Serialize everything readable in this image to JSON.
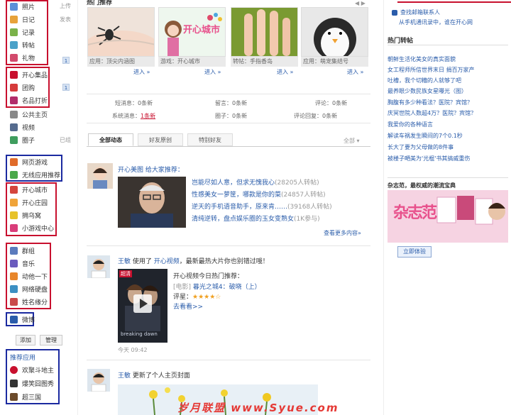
{
  "sidebar": {
    "hint_items": [
      "上传",
      "发表"
    ],
    "group1": [
      "照片",
      "日记",
      "记录",
      "转帖",
      "礼物"
    ],
    "group1_badge": "1",
    "group2": [
      "开心集品",
      "团购",
      "名品打折"
    ],
    "group2_badge": "1",
    "plain": [
      "公共主页",
      "视频",
      "圈子"
    ],
    "plain_hint": "已组",
    "group3": [
      "网页游戏",
      "无线应用推荐"
    ],
    "group4": [
      "开心城市",
      "开心庄园",
      "拥乌窝",
      "小游戏中心"
    ],
    "group5": [
      "群组",
      "音乐",
      "动他一下",
      "网络硬盘",
      "姓名缘分"
    ],
    "group6": [
      "微博"
    ],
    "add_label": "添加",
    "manage_label": "管理",
    "recommend_title": "推荐应用",
    "recommend": [
      "欢聚斗地主",
      "爆笑囧图秀",
      "超三国"
    ]
  },
  "top": {
    "section_title": "热门推荐",
    "photos": [
      {
        "caption": "应用：顶尖内涵图",
        "enter": "进入 »"
      },
      {
        "caption": "游戏：开心城市",
        "enter": "进入 »",
        "logo": "开心城市"
      },
      {
        "caption": "转帖：手指香岛",
        "enter": "进入 »"
      },
      {
        "caption": "应用：萌宠集结号",
        "enter": "进入 »"
      }
    ],
    "more_arrows": "◀ ▶"
  },
  "messages": {
    "rows": [
      [
        {
          "label": "短消息：",
          "value": "0条新"
        },
        {
          "label": "留言：",
          "value": "0条新"
        },
        {
          "label": "评论：",
          "value": "0条新"
        }
      ],
      [
        {
          "label": "系统消息：",
          "value": "1条新"
        },
        {
          "label": "圈子：",
          "value": "0条新"
        },
        {
          "label": "评论回复：",
          "value": "0条新"
        }
      ]
    ]
  },
  "tabs": {
    "items": [
      "全部动态",
      "好友原创",
      "特别好友"
    ],
    "filter": "全部 ▾"
  },
  "feed": {
    "post1": {
      "header": "开心美图 给大家推荐：",
      "items": [
        {
          "title": "岂能尽如人意，但求无愧我心",
          "meta": "(28205人转帖)"
        },
        {
          "title": "性感美女一萝筐，哪款是你的菜",
          "meta": "(24857人转帖)"
        },
        {
          "title": "逆天的手机语音助手，原来肯……",
          "meta": "(39168人转帖)"
        },
        {
          "title": "清纯逆转，盘点娱乐圈的玉女变熟女",
          "meta": "(1K参与)"
        }
      ],
      "more": "查看更多内容»"
    },
    "post2": {
      "user": "王敏",
      "action": "使用了",
      "app": "开心视频",
      "tail": "，最新最热大片你也别错过哦！",
      "list_title": "开心视频今日热门推荐：",
      "movie_tag": "[电影]",
      "movie_name": "暮光之城4：破晓（上）",
      "rating_label": "评星：",
      "stars": "★★★★☆",
      "watch": "去看看>>",
      "time": "今天 09:42",
      "poster_badge": "超清",
      "poster_caption": "breaking dawn"
    },
    "post3": {
      "user": "王敏",
      "action": "更新了个人主页封面"
    }
  },
  "right": {
    "top_links": [
      "查找邮箱联系人",
      "从手机通讯录中，谁在开心网"
    ],
    "hot_title": "热门转帖",
    "hot": [
      "朝鲜生活化美女的真实面貌",
      "女工程师所信世界末日 捐百万家产",
      "吐槽，我个切糟的人就够了吧",
      "最养眼少数民族女星曝光（图）",
      "胸腹有多少种看法？医院？宾馆？",
      "庆冥世院人数超4万？医院？宾馆？",
      "我爱你的各种语言",
      "解读车祸发生瞬间的7个0.1秒",
      "长大了要为父母做的8件事",
      "被楼子嗮美为'光棍'书其搞威重伤"
    ],
    "mag_title": "杂志范，最权威的潮流宝典",
    "mag_logo": "杂志范",
    "mag_button": "立即体验"
  },
  "watermark": "岁月联盟 www.Syue.com"
}
